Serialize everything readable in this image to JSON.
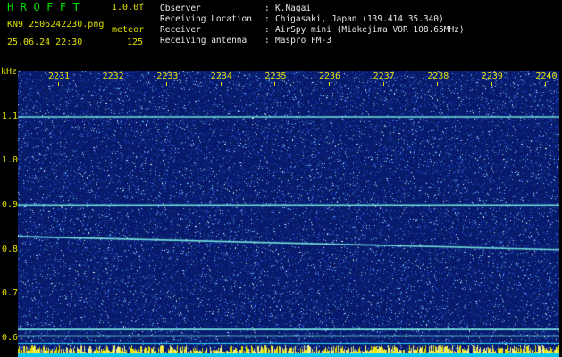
{
  "header": {
    "title": "HROFFT",
    "version": "1.0.0f",
    "filename": "KN9_2506242230.png",
    "mode": "meteor",
    "datetime": "25.06.24 22:30",
    "count": "125"
  },
  "meta": [
    {
      "label": "Observer",
      "value": "K.Nagai"
    },
    {
      "label": "Receiving Location",
      "value": "Chigasaki, Japan (139.414 35.340)"
    },
    {
      "label": "Receiver",
      "value": "AirSpy mini (Miakejima VOR 108.65MHz)"
    },
    {
      "label": "Receiving antenna",
      "value": "Maspro FM-3"
    }
  ],
  "axis": {
    "y_unit": "kHz",
    "y_ticks": [
      "1.1",
      "1.0",
      "0.9",
      "0.8",
      "0.7",
      "0.6"
    ],
    "x_ticks": [
      "2231",
      "2232",
      "2233",
      "2234",
      "2235",
      "2236",
      "2237",
      "2238",
      "2239",
      "2240"
    ]
  },
  "colors": {
    "background": "#000000",
    "header_accent": "#e0e000",
    "title": "#00e000",
    "noise_base": "#0a1466",
    "trace": "#7ff5e8"
  },
  "chart_data": {
    "type": "heatmap",
    "x_range": [
      "2231",
      "2240"
    ],
    "y_range_khz": [
      0.58,
      1.15
    ],
    "traces_khz": [
      {
        "start": 1.1,
        "end": 1.1
      },
      {
        "start": 0.9,
        "end": 0.9
      },
      {
        "start": 0.83,
        "end": 0.8
      },
      {
        "start": 0.62,
        "end": 0.62
      },
      {
        "start": 0.605,
        "end": 0.605
      }
    ]
  }
}
